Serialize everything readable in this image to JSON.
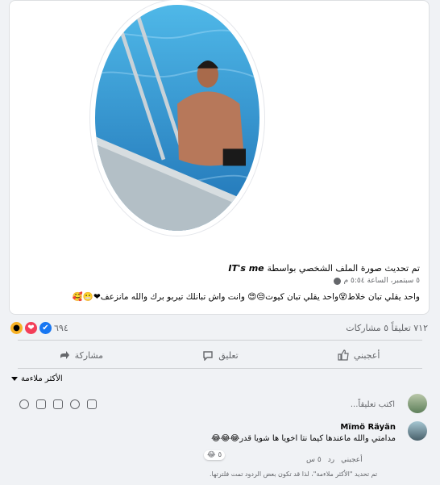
{
  "post": {
    "header_author": "IT's me",
    "header_action": "تم تحديث صورة الملف الشخصي بواسطة",
    "date": "٥ سبتمبر، الساعة ٥:٥٤ م",
    "text": "واحد يقلي تبان خلاط😵واحد يقلي تبان كيوت😒😍 وانت واش تبانلك تيربو برك والله مانزعف❤😬🥰"
  },
  "stats": {
    "reaction_count": "٦٩٤",
    "comments_shares": "٧١٢ تعليقاً ٥ مشاركات"
  },
  "actions": {
    "like": "أعجبني",
    "comment": "تعليق",
    "share": "مشاركة"
  },
  "comments": {
    "sort_label": "الأكثر ملاءمة",
    "input_placeholder": "اكتب تعليقاً...",
    "first": {
      "author": "Mïmö Räyän",
      "text": "مدامتي والله ماعندها كيما نتا اخويا ها شويا قدر😂😂😂",
      "reaction_count": "٥",
      "like": "أعجبني",
      "reply": "رد",
      "time": "٥ س"
    },
    "note": "تم تحديد \"الأكثر ملاءمة\"، لذا قد تكون بعض الردود تمت فلترتها."
  },
  "colors": {
    "brand": "#1877f2",
    "love": "#f33e58",
    "wow": "#f7b125"
  }
}
